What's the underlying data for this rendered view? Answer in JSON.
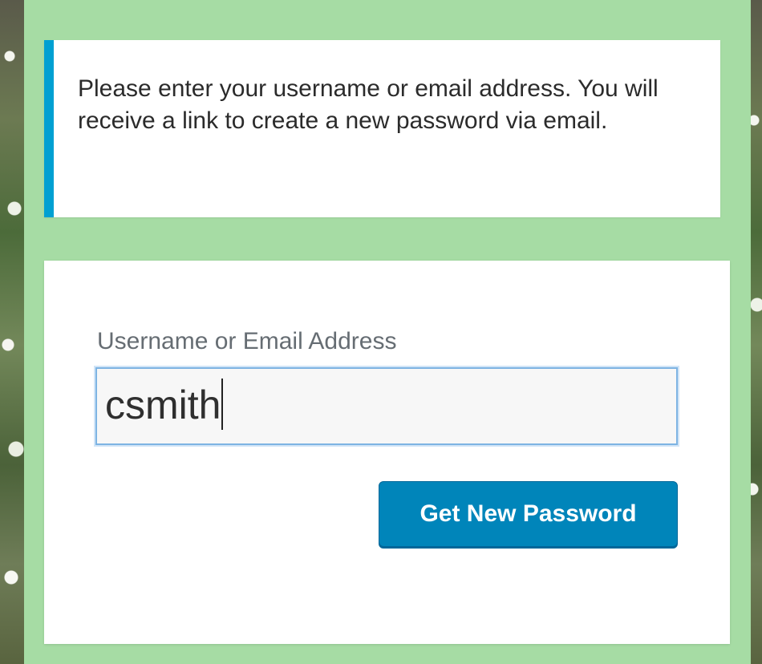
{
  "notice": {
    "text": "Please enter your username or email address. You will receive a link to create a new password via email."
  },
  "form": {
    "label": "Username or Email Address",
    "input_value": "csmith",
    "submit_label": "Get New Password"
  },
  "colors": {
    "panel_bg": "#a6dca4",
    "notice_border": "#00a0d2",
    "button_bg": "#0085ba",
    "input_focus": "#7eb4e3"
  }
}
